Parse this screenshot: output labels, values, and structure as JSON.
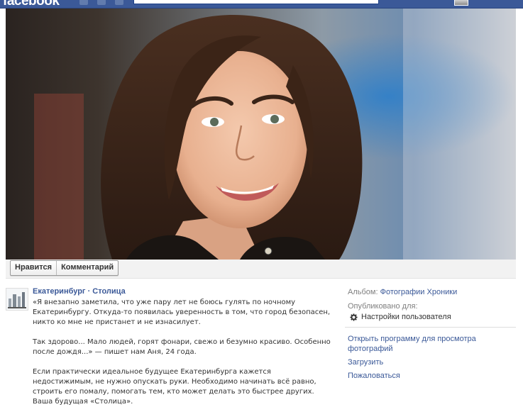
{
  "topbar": {
    "logo_text": "facebook",
    "search_placeholder": ""
  },
  "photo": {
    "description_icon": "photo-image"
  },
  "actions": {
    "like_label": "Нравится",
    "comment_label": "Комментарий"
  },
  "post": {
    "author": "Екатеринбург · Столица",
    "paragraphs": [
      "«Я внезапно заметила, что уже пару лет не боюсь гулять по ночному Екатеринбургу. Откуда-то появилась уверенность в том, что город безопасен, никто ко мне не пристанет и не изнасилует.",
      "Так здорово... Мало людей, горят фонари, свежо и безумно красиво. Особенно после дождя...» — пишет нам Аня, 24 года.",
      "Если практически идеальное будущее Екатеринбурга кажется недостижимым, не нужно опускать руки. Необходимо начинать всё равно, строить его помалу, помогать тем, кто может делать это быстрее других. Ваша будущая «Столица»."
    ]
  },
  "side": {
    "album_label": "Альбом:",
    "album_link": "Фотографии Хроники",
    "published_label": "Опубликовано для:",
    "privacy_value": "Настройки пользователя",
    "links": {
      "open_viewer": "Открыть программу для просмотра фотографий",
      "download": "Загрузить",
      "report": "Пожаловаться"
    }
  },
  "colors": {
    "brand": "#3b5998",
    "link": "#3b5998",
    "text": "#333333",
    "muted": "#808080"
  }
}
